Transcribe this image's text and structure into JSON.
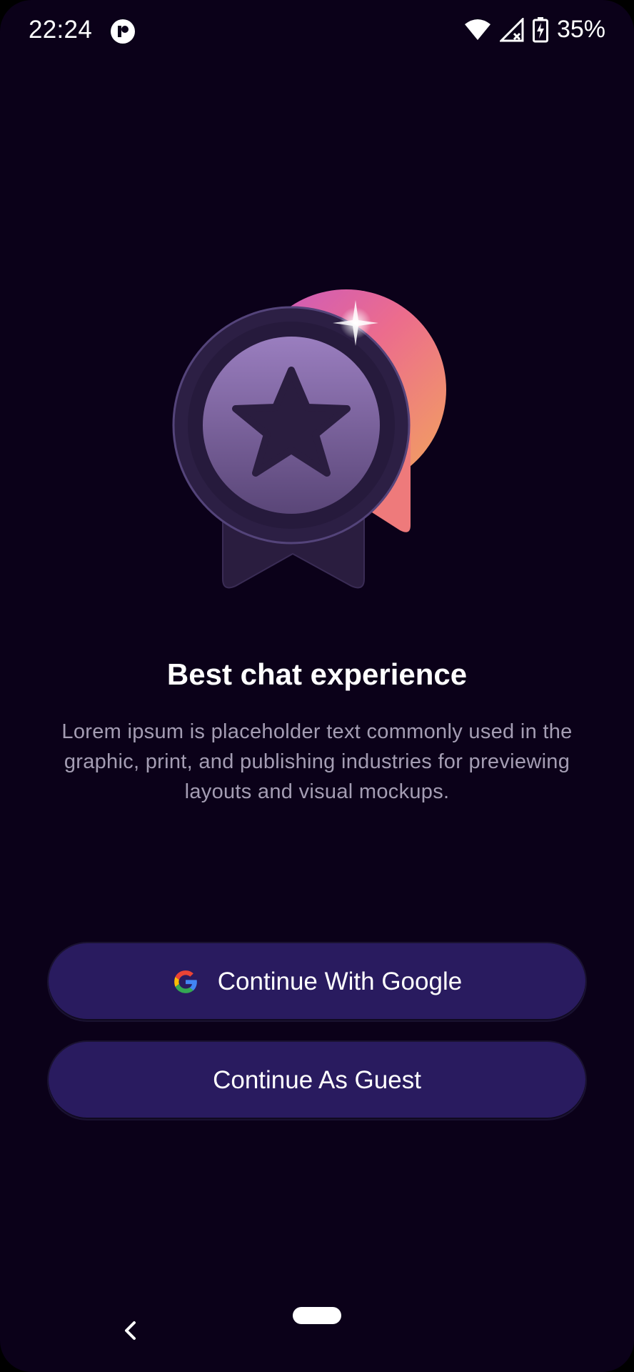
{
  "status_bar": {
    "time": "22:24",
    "battery_percent": "35%",
    "icons": [
      "app-indicator-icon",
      "wifi-icon",
      "signal-icon",
      "battery-charging-icon"
    ]
  },
  "hero": {
    "illustration": "medal-star-icon"
  },
  "onboarding": {
    "title": "Best chat experience",
    "description": "Lorem ipsum is placeholder text commonly used in the graphic, print, and publishing industries for previewing layouts and visual mockups."
  },
  "actions": {
    "google_label": "Continue With Google",
    "guest_label": "Continue As Guest"
  },
  "nav_bar": {
    "icons": [
      "back-icon",
      "home-pill-icon"
    ]
  },
  "colors": {
    "background": "#0b0119",
    "button": "#291b5f",
    "description_text": "#a49db3",
    "accent_gradient_start": "#d667b8",
    "accent_gradient_end": "#f2a25b"
  }
}
